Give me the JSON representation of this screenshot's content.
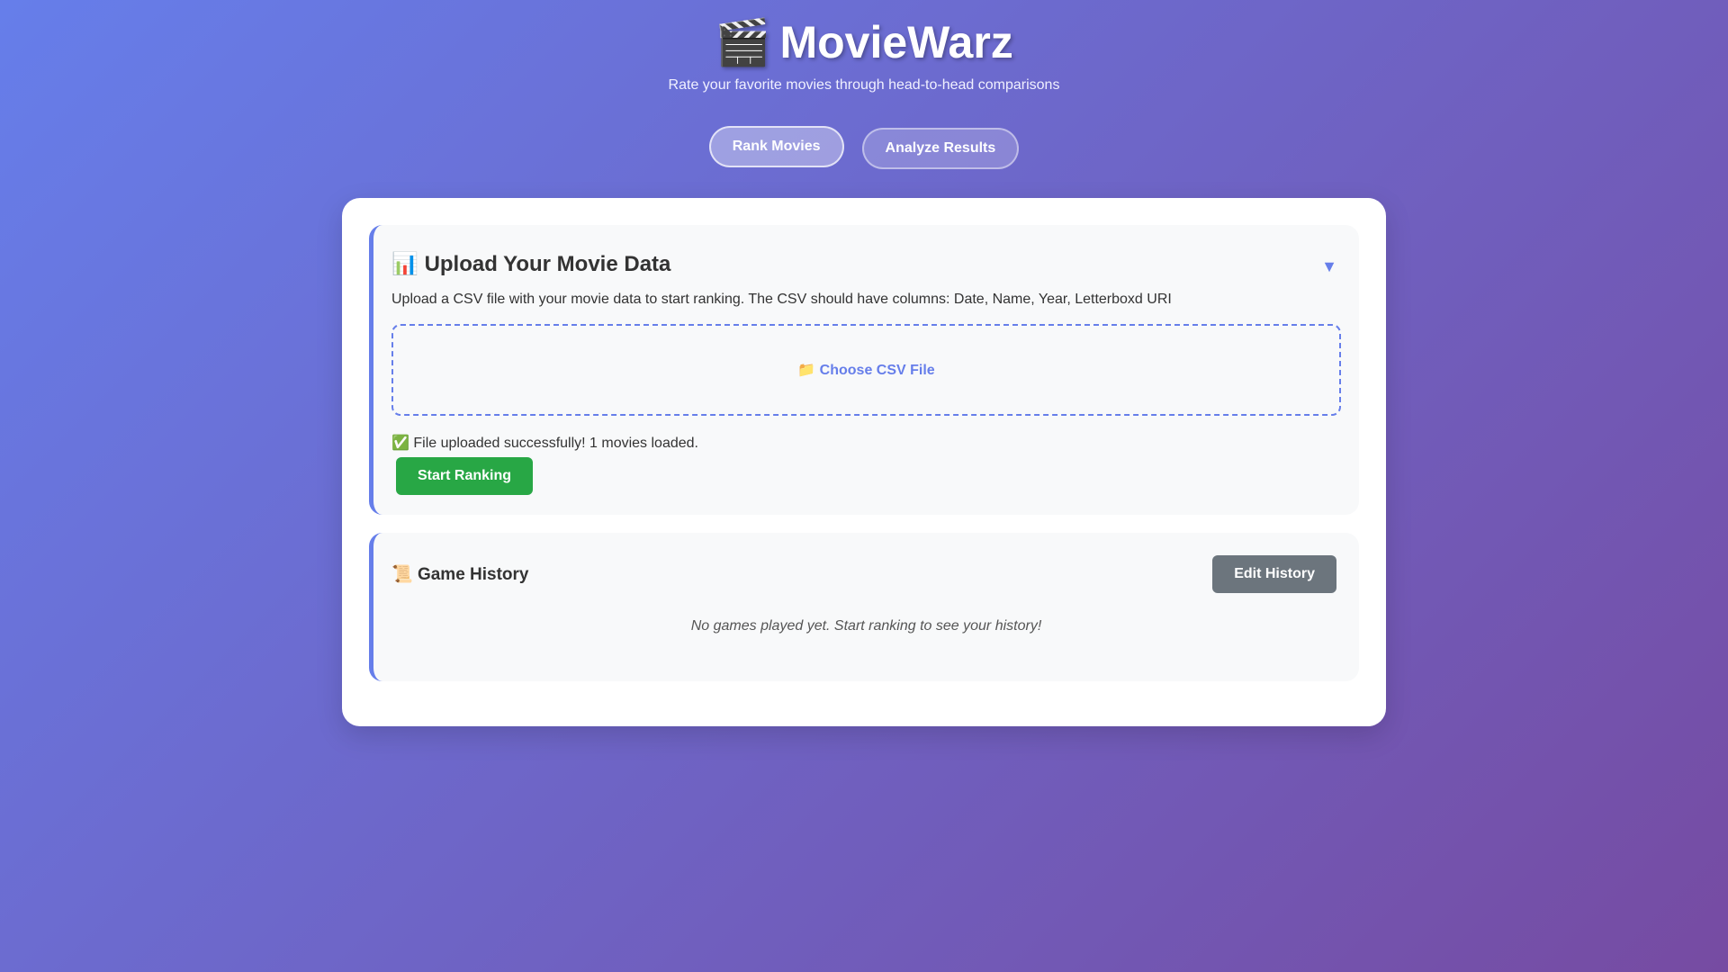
{
  "header": {
    "icon": "🎬",
    "title": "MovieWarz",
    "subtitle": "Rate your favorite movies through head-to-head comparisons"
  },
  "nav": {
    "tabs": [
      {
        "label": "Rank Movies",
        "active": true
      },
      {
        "label": "Analyze Results",
        "active": false
      }
    ]
  },
  "upload": {
    "icon": "📊",
    "title": "Upload Your Movie Data",
    "toggle_icon": "▼",
    "description": "Upload a CSV file with your movie data to start ranking. The CSV should have columns: Date, Name, Year, Letterboxd URI",
    "dropzone_icon": "📁",
    "dropzone_label": "Choose CSV File",
    "status_icon": "✅",
    "status_text": "File uploaded successfully! 1 movies loaded.",
    "start_button": "Start Ranking"
  },
  "history": {
    "icon": "📜",
    "title": "Game History",
    "edit_button": "Edit History",
    "empty_message": "No games played yet. Start ranking to see your history!"
  },
  "colors": {
    "accent": "#667eea",
    "gradient_end": "#764ba2",
    "success": "#28a745",
    "secondary": "#6c757d"
  }
}
